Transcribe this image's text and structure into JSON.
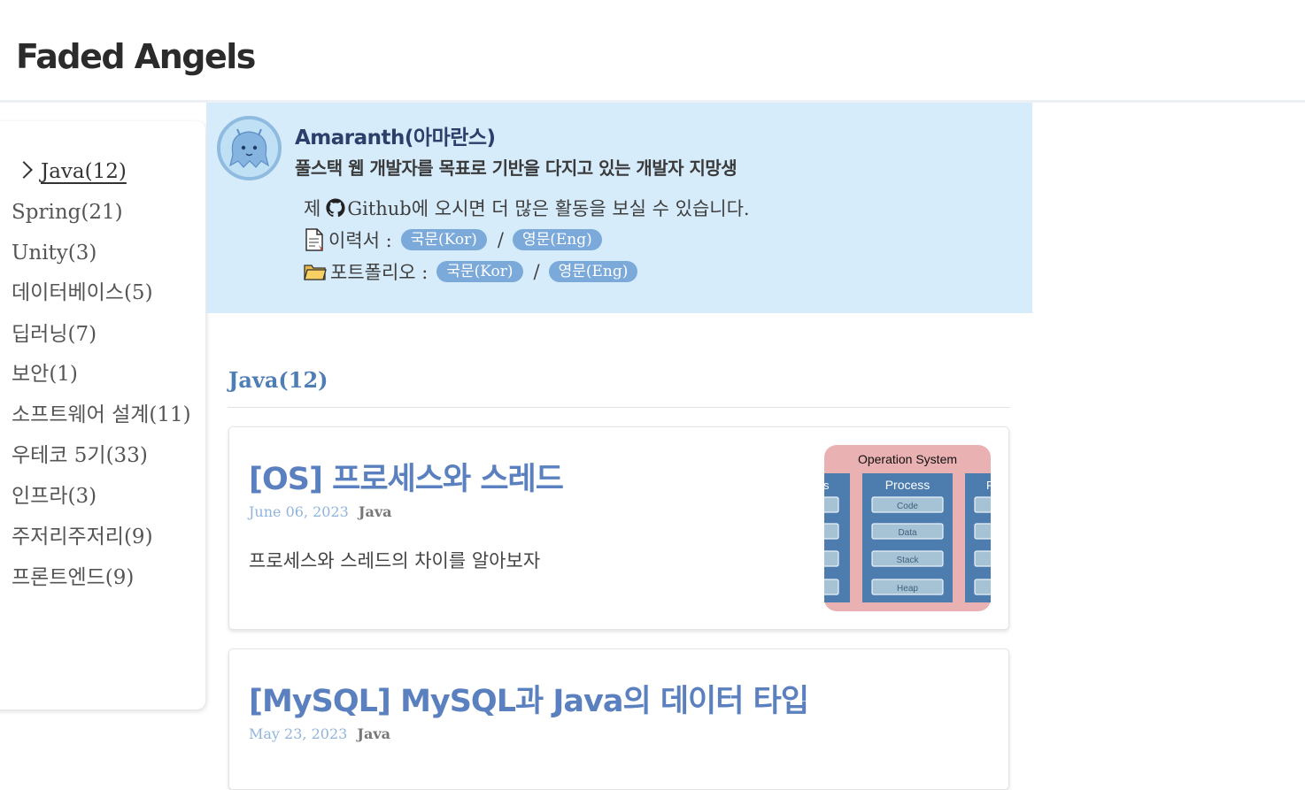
{
  "site": {
    "title": "Faded Angels"
  },
  "sidebar": {
    "categories": [
      {
        "label": "Java(12)",
        "active": true
      },
      {
        "label": "Spring(21)"
      },
      {
        "label": "Unity(3)"
      },
      {
        "label": "데이터베이스(5)"
      },
      {
        "label": "딥러닝(7)"
      },
      {
        "label": "보안(1)"
      },
      {
        "label": "소프트웨어 설계(11)"
      },
      {
        "label": "우테코 5기(33)"
      },
      {
        "label": "인프라(3)"
      },
      {
        "label": "주저리주저리(9)"
      },
      {
        "label": "프론트엔드(9)"
      }
    ]
  },
  "profile": {
    "name": "Amaranth(아마란스)",
    "bio": "풀스택 웹 개발자를 목표로 기반을 다지고 있는 개발자 지망생",
    "github_prefix": "제",
    "github_text": "Github에 오시면 더 많은 활동을 보실 수 있습니다.",
    "resume_label": "이력서 :",
    "portfolio_label": "포트폴리오 :",
    "kor_label": "국문(Kor)",
    "eng_label": "영문(Eng)",
    "separator": "/",
    "icons": [
      "github-icon",
      "document-icon",
      "folder-icon"
    ]
  },
  "main": {
    "heading": "Java(12)",
    "posts": [
      {
        "title": "[OS] 프로세스와 스레드",
        "date": "June 06, 2023",
        "category": "Java",
        "excerpt": "프로세스와 스레드의 차이를 알아보자",
        "thumbnail": {
          "title": "Operation System",
          "center_label": "Process",
          "side_label_left": "s",
          "side_label_right": "P",
          "segments": [
            "Code",
            "Data",
            "Stack",
            "Heap"
          ]
        }
      },
      {
        "title": "[MySQL] MySQL과 Java의 데이터 타입",
        "date": "May 23, 2023",
        "category": "Java"
      }
    ]
  },
  "colors": {
    "profile_bg": "#d7ecfb",
    "accent": "#5b80bf",
    "pill": "#7aa9da",
    "thumb_bg": "#e9b1b1",
    "thumb_block": "#4d7cae"
  }
}
